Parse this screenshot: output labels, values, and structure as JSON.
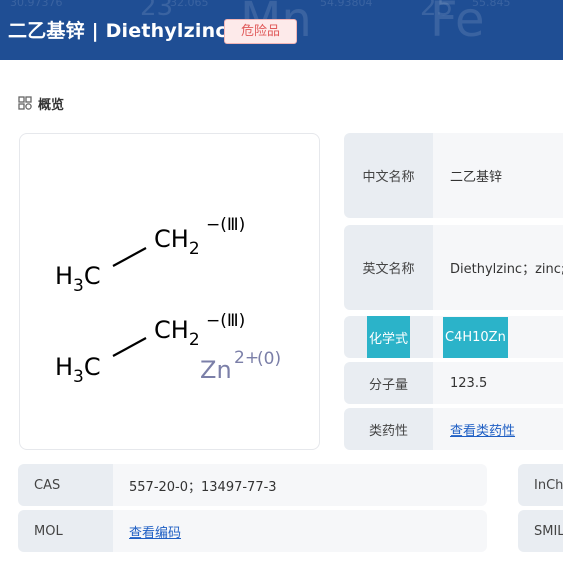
{
  "header": {
    "title": "二乙基锌 | Diethylzinc",
    "hazard_badge": "危险品",
    "bg_color": "#1f4e94"
  },
  "overview": {
    "icon": "grid-icon",
    "title": "概览"
  },
  "structure": {
    "ch2_top": "CH",
    "ch2_top_sub": "2",
    "ch2_top_charge": "−(Ⅲ)",
    "ch3_top": "H",
    "ch3_top_sub": "3",
    "ch3_top_c": "C",
    "ch2_bottom": "CH",
    "ch2_bottom_sub": "2",
    "ch2_bottom_charge": "−(Ⅲ)",
    "ch3_bottom": "H",
    "ch3_bottom_sub": "3",
    "ch3_bottom_c": "C",
    "zn": "Zn",
    "zn_charge": "2+",
    "zn_oxidation": "(0)"
  },
  "properties": [
    {
      "label": "中文名称",
      "value": "二乙基锌"
    },
    {
      "label": "英文名称",
      "value": "Diethylzinc；zinc;eth"
    },
    {
      "label": "化学式",
      "value": "C4H10Zn"
    },
    {
      "label": "分子量",
      "value": "123.5"
    },
    {
      "label": "类药性",
      "value": "查看类药性"
    }
  ],
  "bottom_rows": [
    {
      "label": "CAS",
      "value": "557-20-0；13497-77-3"
    },
    {
      "label": "MOL",
      "value": "查看编码"
    }
  ],
  "right_rows": [
    {
      "label": "InChI"
    },
    {
      "label": "SMILES"
    }
  ],
  "colors": {
    "accent": "#2bb3c9",
    "link": "#1f5fc4",
    "badge_text": "#e05a5a"
  }
}
